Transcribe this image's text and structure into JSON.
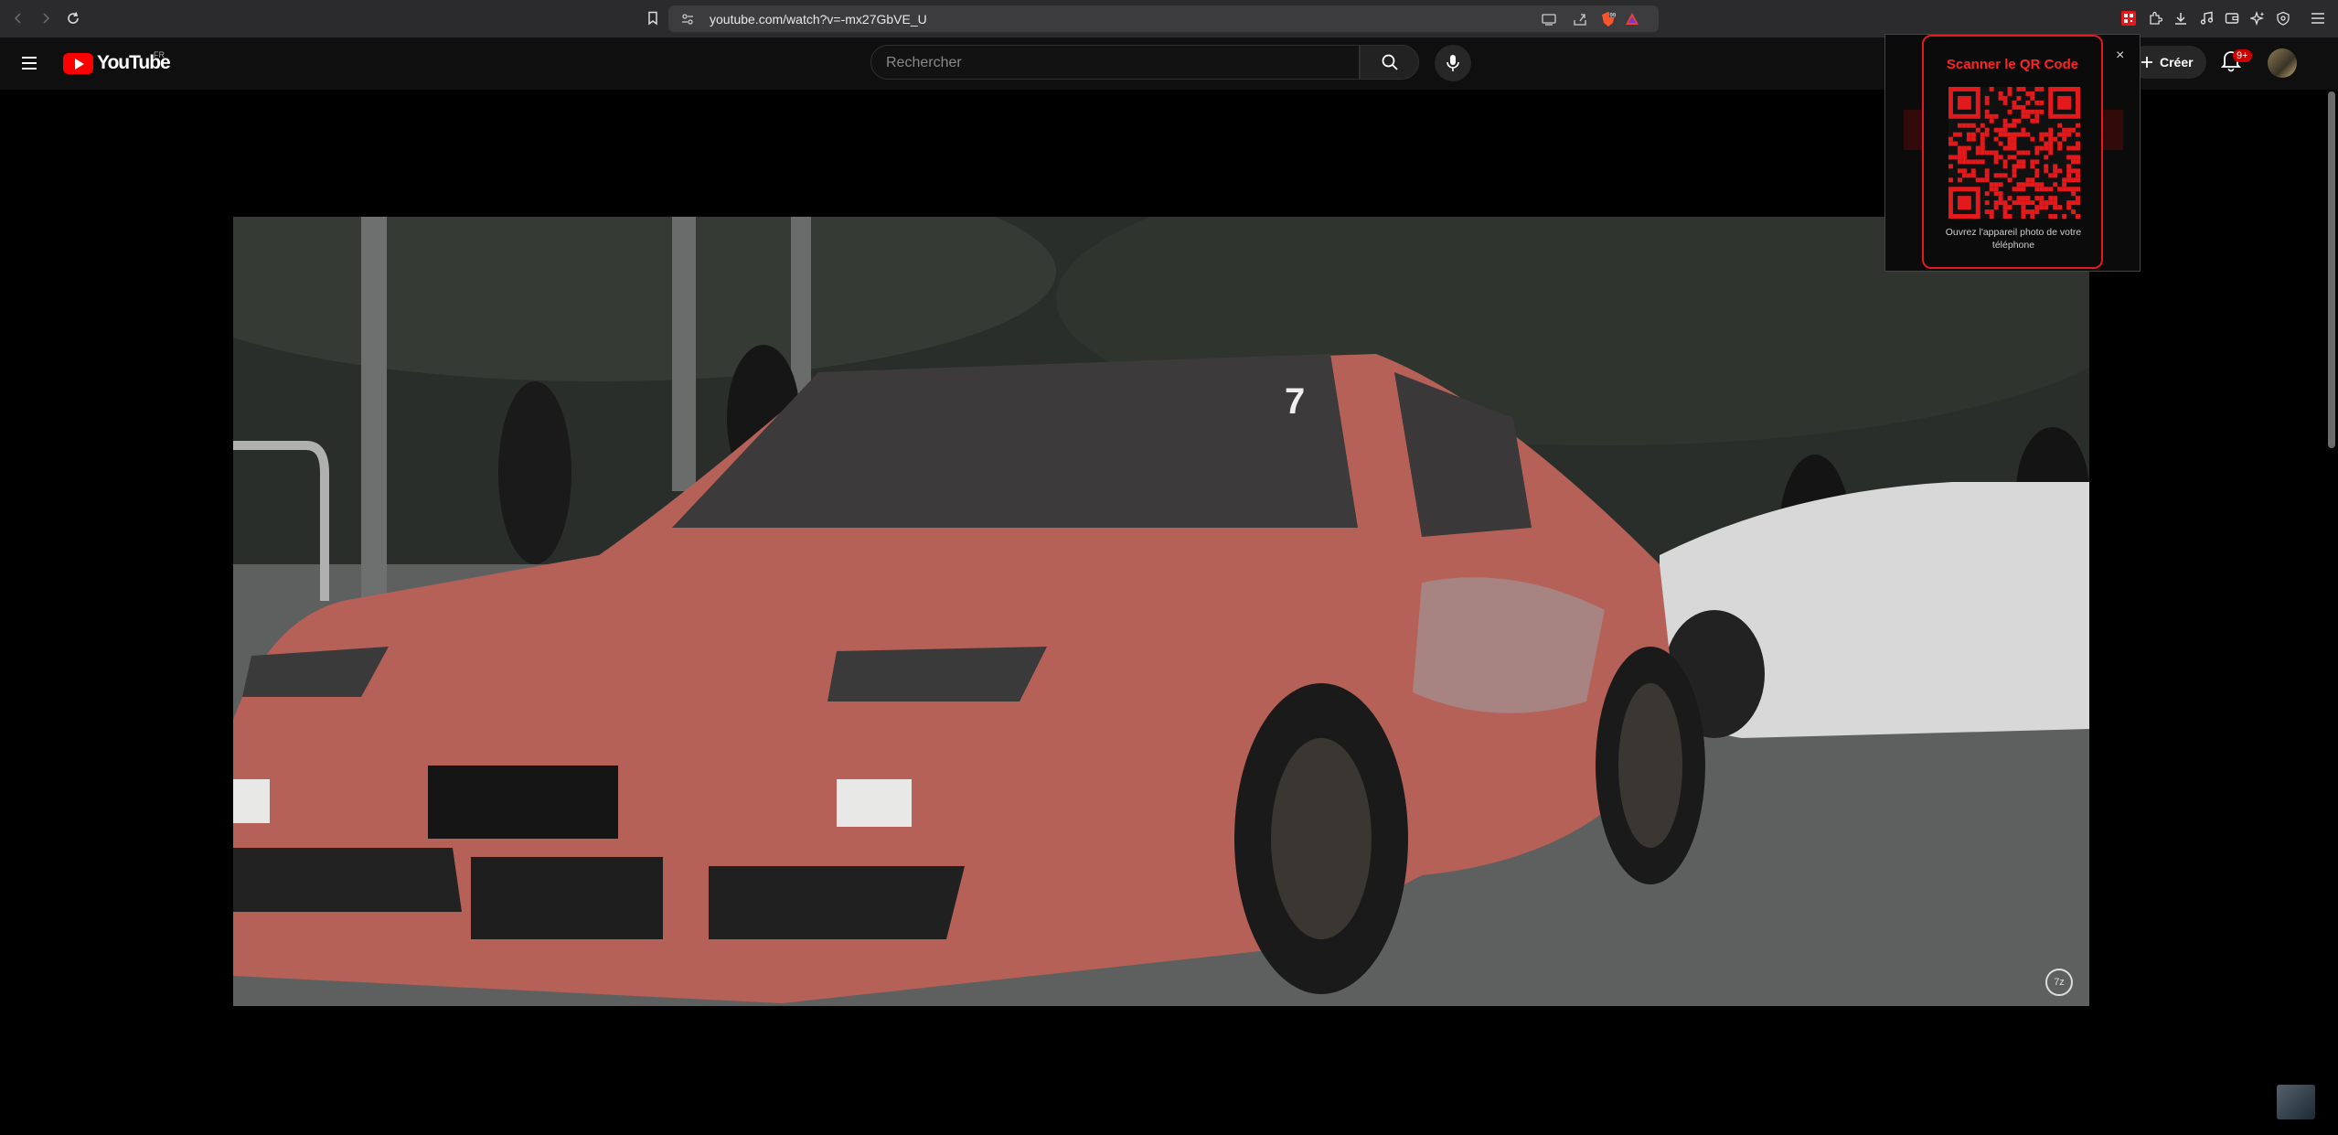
{
  "browser": {
    "url": "youtube.com/watch?v=-mx27GbVE_U"
  },
  "youtube": {
    "logo_text": "YouTube",
    "country_code": "FR",
    "search_placeholder": "Rechercher",
    "create_label": "Créer",
    "notification_count": "9+"
  },
  "video": {
    "windshield_number": "7"
  },
  "qr_popup": {
    "title": "Scanner le QR Code",
    "caption_line1": "Ouvrez l'appareil photo de votre",
    "caption_line2": "téléphone",
    "close": "×"
  },
  "colors": {
    "brand_red": "#ff0000",
    "qr_accent": "#e3191b",
    "header_bg": "#0f0f0f"
  },
  "icons": [
    "back-arrow-icon",
    "forward-arrow-icon",
    "reload-icon",
    "bookmark-icon",
    "site-settings-icon",
    "cast-icon",
    "share-icon",
    "brave-shields-icon",
    "brave-rewards-icon",
    "qr-extension-icon",
    "extensions-icon",
    "download-icon",
    "media-icon",
    "wallet-icon",
    "leo-ai-icon",
    "vpn-icon",
    "menu-icon",
    "search-icon",
    "mic-icon",
    "plus-icon",
    "bell-icon"
  ]
}
